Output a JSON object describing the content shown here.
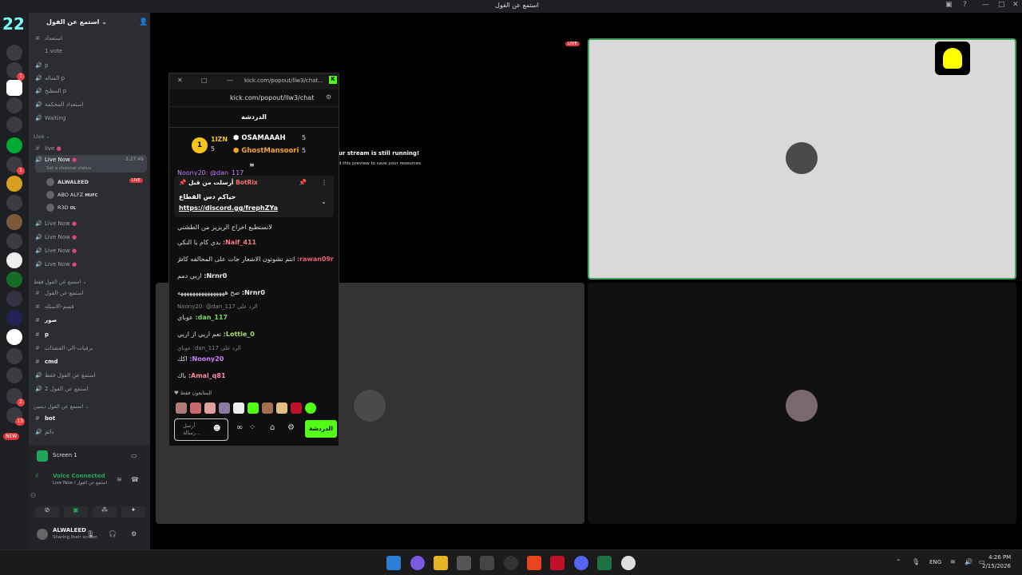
{
  "window": {
    "title": "استمع عن الفول"
  },
  "servers": {
    "badges": [
      "1",
      "1",
      "2",
      "3",
      "13",
      "NEW"
    ]
  },
  "sidebar": {
    "server_name": "استمع عن الفول",
    "vote": "1 vote",
    "channels_top": [
      {
        "label": "استعداد",
        "icon": "#"
      },
      {
        "label": "p",
        "icon": "🔊"
      },
      {
        "label": "الساله p",
        "icon": "🔊"
      },
      {
        "label": "المطبخ p",
        "icon": "🔊"
      },
      {
        "label": "استعداد المحكمة",
        "icon": "🔊"
      },
      {
        "label": "Waiting",
        "icon": "🔊"
      }
    ],
    "cat_live": "Live",
    "live_channels": [
      {
        "label": "live"
      },
      {
        "label": "Live Now",
        "sub": "Set a channel status",
        "time": "2:27:49"
      }
    ],
    "voice_users": [
      {
        "name": "ALWALEED",
        "live": "LIVE"
      },
      {
        "name": "ABO ALFZ",
        "tag": "MUFC"
      },
      {
        "name": "R3D",
        "tag": "OL"
      }
    ],
    "more_live": [
      "Live Now",
      "Live Now",
      "Live Now",
      "Live Now"
    ],
    "cat2": "استمع عن الفول فقط",
    "channels_mid": [
      {
        "label": "استمع-عن-القول",
        "icon": "#"
      },
      {
        "label": "قسم-الاسئله",
        "icon": "#"
      },
      {
        "label": "صور",
        "icon": "#"
      },
      {
        "label": "p",
        "icon": "#"
      },
      {
        "label": "برفيات-الي-القنفذات",
        "icon": "#"
      },
      {
        "label": "cmd",
        "icon": "#"
      },
      {
        "label": "استمع عن الفول فقط",
        "icon": "🔊"
      },
      {
        "label": "استمع عن الفول 2",
        "icon": "🔊"
      }
    ],
    "cat3": "استمع عن الفول دينبين",
    "channels_bot": [
      {
        "label": "bot",
        "icon": "#"
      },
      {
        "label": "دائم",
        "icon": "🔊"
      }
    ]
  },
  "voice": {
    "screen": "Screen 1",
    "connected": "Voice Connected",
    "channel": "Live Now / استمع عن الفول",
    "user": "ALWALEED",
    "status": "Sharing their screen"
  },
  "stage": {
    "live_badge": "LIVE",
    "notice_title": "ur stream is still running!",
    "notice_body": "d this preview to save your resources."
  },
  "popout": {
    "url_small": "kick.com/popout/llw3/chat...",
    "url": "kick.com/popout/llw3/chat",
    "header": "الدردشة",
    "leaders": [
      {
        "name": "1IZN",
        "count": "5"
      },
      {
        "name": "OSAMAAAH",
        "count": "5"
      },
      {
        "name": "GhostMansoori",
        "count": "5"
      }
    ],
    "rank": "1",
    "pinned": {
      "label": "أرسلت من قبل",
      "by": "BotRix",
      "text": "حياكم دس القطاع",
      "link": "https://discord.gg/frephZYa"
    },
    "partial": "Noony20: @dan_117",
    "messages": [
      {
        "user": "",
        "text": "لاتستطيع اخراج الريزيز من الطشتي",
        "color": "#ddd"
      },
      {
        "user": "Naif_411:",
        "text": "بدي كام يا النكي",
        "color": "#f47a8c"
      },
      {
        "user": "rawan09r:",
        "text": "انتم تشوتون الاشعار جات على المحالفه كاش",
        "color": "#e85d75"
      },
      {
        "user": "Nrnr0:",
        "text": "اريي دمم",
        "color": "#eee"
      },
      {
        "user": "Nrnr0:",
        "text": "صح ههههههههههههههههه",
        "color": "#eee"
      },
      {
        "user": "",
        "text": "الرد على Noony20: @dan_117",
        "color": "#888"
      },
      {
        "user": "dan_117:",
        "text": "عوباي",
        "color": "#7fd36b"
      },
      {
        "user": "Lottie_0:",
        "text": "تعم اريي از اريي",
        "color": "#a8e05f"
      },
      {
        "user": "",
        "text": "الرد على dan_117: عوباي",
        "color": "#888"
      },
      {
        "user": "Noony20:",
        "text": "اكك",
        "color": "#c985ff"
      },
      {
        "user": "Amal_q81:",
        "text": "باك",
        "color": "#f78fa7"
      }
    ],
    "followers": "المتابعون فقط",
    "input_placeholder": "أرسل رسالة...",
    "chat_button": "الدردشة"
  },
  "taskbar": {
    "lang": "ENG",
    "time": "4:26 PM",
    "date": "2/15/2026"
  }
}
